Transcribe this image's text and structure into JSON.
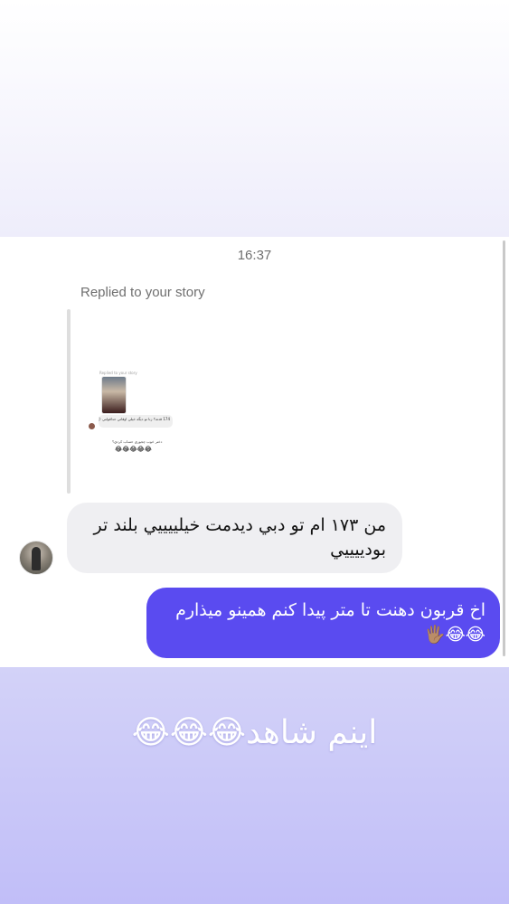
{
  "thread": {
    "timestamp": "16:37",
    "reply_label": "Replied to your story"
  },
  "story_preview": {
    "caption": "Replied to your story",
    "line1": "174 قدته؟ زنا تو ديگه خيلي اوقاتي حداقولتي 😊",
    "line2": "دختر خوب چجوري حساب کردي؟",
    "emoji": "😂😂😂😂😂"
  },
  "messages": [
    {
      "sender": "other",
      "text": "من ۱۷۳ ام تو دبي ديدمت خيلييييي بلند تر بودييييي"
    },
    {
      "sender": "me",
      "text": "اخ قربون دهنت تا متر پيدا کنم همينو ميذارم 😂😂🖐🏽"
    }
  ],
  "overlay": {
    "text": "اينم شاهد😂😂😂"
  },
  "colors": {
    "outgoing_bubble": "#5a4bf0",
    "incoming_bubble": "#efeff2",
    "overlay_background": "#c9c7f8"
  }
}
